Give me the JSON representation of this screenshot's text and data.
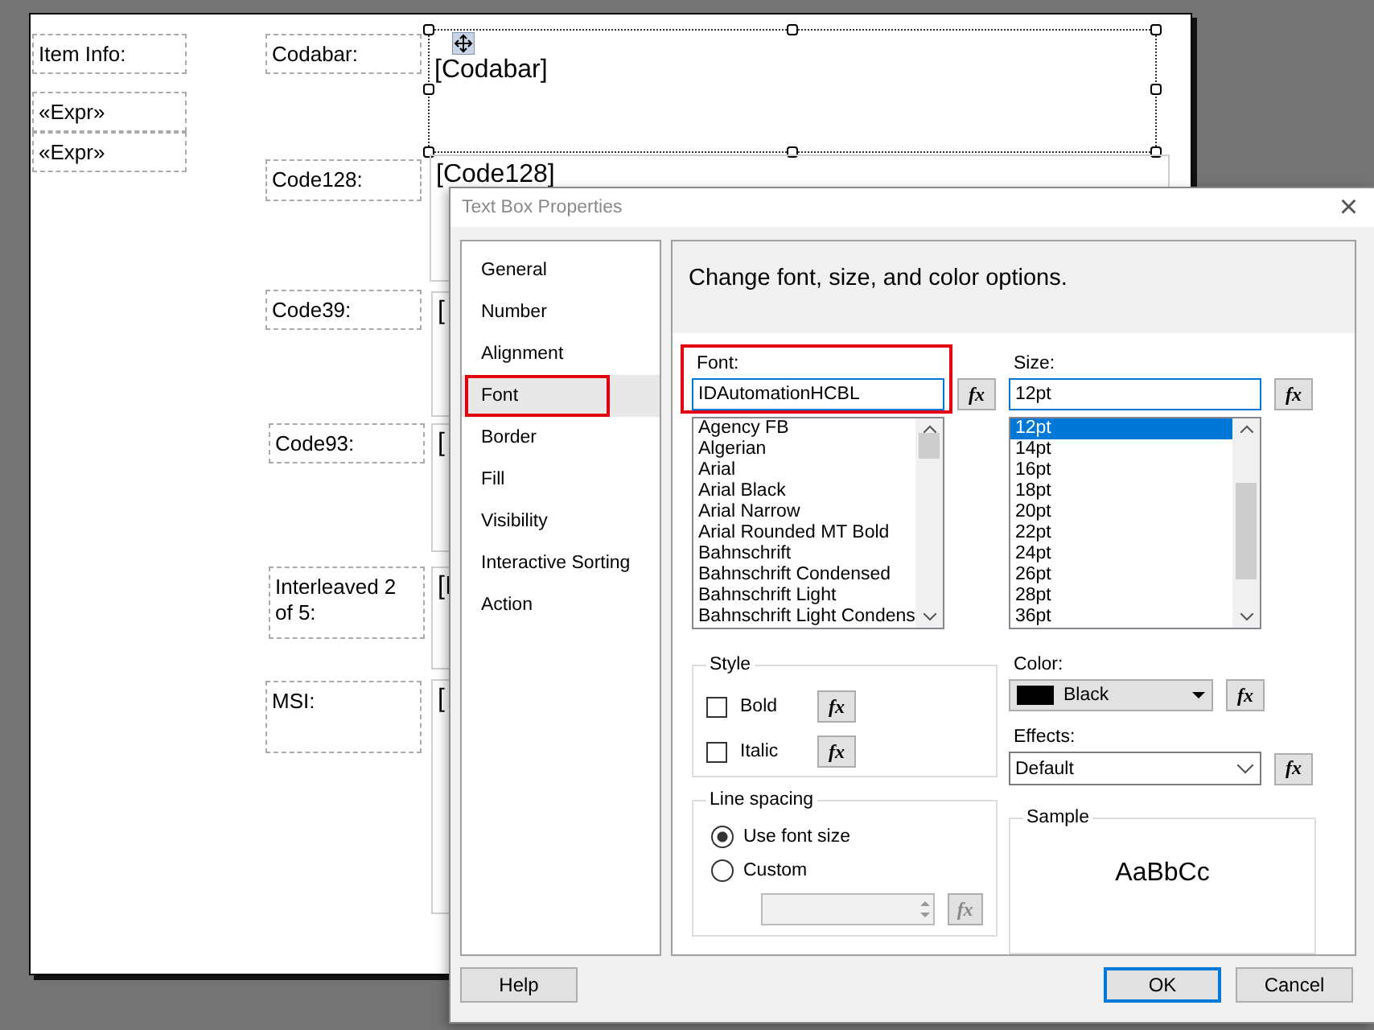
{
  "canvas": {
    "left_items": [
      {
        "text": "Item Info:"
      },
      {
        "text": "«Expr»"
      },
      {
        "text": "«Expr»"
      }
    ],
    "barcode_rows": [
      {
        "label": "Codabar:",
        "value": "[Codabar]",
        "selected": true
      },
      {
        "label": "Code128:",
        "value": "[Code128]",
        "selected": false
      },
      {
        "label": "Code39:",
        "value": "[",
        "selected": false
      },
      {
        "label": "Code93:",
        "value": "[",
        "selected": false
      },
      {
        "label": "Interleaved 2 of 5:",
        "value": "[I",
        "selected": false
      },
      {
        "label": "MSI:",
        "value": "[",
        "selected": false
      }
    ]
  },
  "dialog": {
    "title": "Text Box Properties",
    "close": "×",
    "nav": [
      {
        "label": "General",
        "selected": false,
        "highlighted": false
      },
      {
        "label": "Number",
        "selected": false,
        "highlighted": false
      },
      {
        "label": "Alignment",
        "selected": false,
        "highlighted": false
      },
      {
        "label": "Font",
        "selected": true,
        "highlighted": true
      },
      {
        "label": "Border",
        "selected": false,
        "highlighted": false
      },
      {
        "label": "Fill",
        "selected": false,
        "highlighted": false
      },
      {
        "label": "Visibility",
        "selected": false,
        "highlighted": false
      },
      {
        "label": "Interactive Sorting",
        "selected": false,
        "highlighted": false
      },
      {
        "label": "Action",
        "selected": false,
        "highlighted": false
      }
    ],
    "heading": "Change font, size, and color options.",
    "font": {
      "label": "Font:",
      "value": "IDAutomationHCBL",
      "fx": "fx",
      "highlighted": true,
      "options": [
        {
          "text": "Agency FB",
          "selected": false
        },
        {
          "text": "Algerian",
          "selected": false
        },
        {
          "text": "Arial",
          "selected": false
        },
        {
          "text": "Arial Black",
          "selected": false
        },
        {
          "text": "Arial Narrow",
          "selected": false
        },
        {
          "text": "Arial Rounded MT Bold",
          "selected": false
        },
        {
          "text": "Bahnschrift",
          "selected": false
        },
        {
          "text": "Bahnschrift Condensed",
          "selected": false
        },
        {
          "text": "Bahnschrift Light",
          "selected": false
        },
        {
          "text": "Bahnschrift Light Condens",
          "selected": false
        }
      ]
    },
    "size": {
      "label": "Size:",
      "value": "12pt",
      "fx": "fx",
      "options": [
        {
          "text": "12pt",
          "selected": true
        },
        {
          "text": "14pt",
          "selected": false
        },
        {
          "text": "16pt",
          "selected": false
        },
        {
          "text": "18pt",
          "selected": false
        },
        {
          "text": "20pt",
          "selected": false
        },
        {
          "text": "22pt",
          "selected": false
        },
        {
          "text": "24pt",
          "selected": false
        },
        {
          "text": "26pt",
          "selected": false
        },
        {
          "text": "28pt",
          "selected": false
        },
        {
          "text": "36pt",
          "selected": false
        }
      ]
    },
    "style": {
      "title": "Style",
      "options": [
        {
          "label": "Bold",
          "checked": false,
          "fx": "fx"
        },
        {
          "label": "Italic",
          "checked": false,
          "fx": "fx"
        }
      ]
    },
    "color": {
      "label": "Color:",
      "value": "Black",
      "color": "#000000",
      "fx": "fx"
    },
    "effects": {
      "label": "Effects:",
      "value": "Default",
      "fx": "fx"
    },
    "line_spacing": {
      "title": "Line spacing",
      "options": [
        {
          "label": "Use font size",
          "selected": true
        },
        {
          "label": "Custom",
          "selected": false
        }
      ],
      "custom_disabled": true,
      "fx": "fx"
    },
    "sample": {
      "title": "Sample",
      "text": "AaBbCc"
    },
    "buttons": [
      {
        "label": "Help",
        "default": false
      },
      {
        "label": "OK",
        "default": true
      },
      {
        "label": "Cancel",
        "default": false
      }
    ]
  }
}
